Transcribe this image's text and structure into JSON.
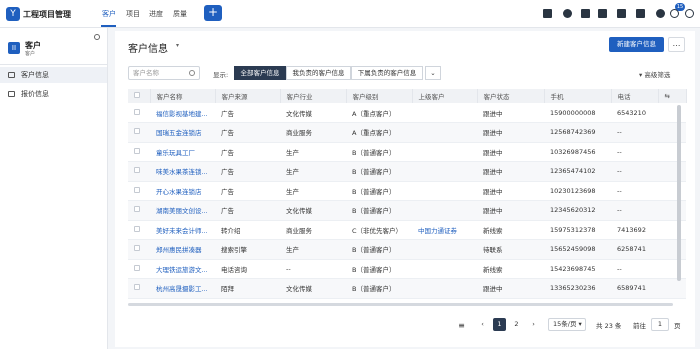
{
  "app": {
    "title": "工程项目管理",
    "logo_char": "Y"
  },
  "nav": {
    "tabs": [
      "客户",
      "项目",
      "进度",
      "质量"
    ],
    "active": "客户"
  },
  "topbar": {
    "plus": "+",
    "notify_count": "15"
  },
  "sidebar": {
    "title": "客户",
    "subtitle": "客户",
    "icon_char": "II",
    "items": [
      "客户信息",
      "报价信息"
    ]
  },
  "page": {
    "title": "客户信息",
    "caret": "▾",
    "new_button": "新建客户信息",
    "more": "…"
  },
  "toolbar": {
    "search_placeholder": "客户名称",
    "show_label": "显示:",
    "segments": [
      "全部客户信息",
      "我负责的客户信息",
      "下属负责的客户信息"
    ],
    "segment_caret": "⌄",
    "filter": "高级筛选"
  },
  "table": {
    "headers": [
      "客户名称",
      "客户来源",
      "客户行业",
      "客户级别",
      "上级客户",
      "客户状态",
      "手机",
      "电话"
    ],
    "rows": [
      [
        "福信影视基地建...",
        "广告",
        "文化传媒",
        "A（重点客户）",
        "",
        "跟进中",
        "15900000008",
        "6543210"
      ],
      [
        "国瑞五金连锁店",
        "广告",
        "商业服务",
        "A（重点客户）",
        "",
        "跟进中",
        "12568742369",
        "--"
      ],
      [
        "童乐玩具工厂",
        "广告",
        "生产",
        "B（普通客户）",
        "",
        "跟进中",
        "10326987456",
        "--"
      ],
      [
        "味美水果茶连锁...",
        "广告",
        "生产",
        "B（普通客户）",
        "",
        "跟进中",
        "12365474102",
        "--"
      ],
      [
        "开心水果连锁店",
        "广告",
        "生产",
        "B（普通客户）",
        "",
        "跟进中",
        "10230123698",
        "--"
      ],
      [
        "湖南美丽文创设...",
        "广告",
        "文化传媒",
        "B（普通客户）",
        "",
        "跟进中",
        "12345620312",
        "--"
      ],
      [
        "美好未来会计师...",
        "转介绍",
        "商业服务",
        "C（非优先客户）",
        "中国力通证券",
        "新线索",
        "15975312378",
        "7413692"
      ],
      [
        "郑州惠民拼凑器",
        "搜索引擎",
        "生产",
        "B（普通客户）",
        "",
        "待联系",
        "15652459098",
        "6258741"
      ],
      [
        "大理铁运旅游文...",
        "电话咨询",
        "--",
        "B（普通客户）",
        "",
        "新线索",
        "15423698745",
        "--"
      ],
      [
        "杭州高晟摄影工...",
        "陌拜",
        "文化传媒",
        "B（普通客户）",
        "",
        "跟进中",
        "13365230236",
        "6589741"
      ]
    ]
  },
  "pager": {
    "pages": [
      "1",
      "2"
    ],
    "current": "1",
    "next": "›",
    "prev": "‹",
    "page_size": "15条/页",
    "total": "共 23 条",
    "goto_label": "前往",
    "goto_value": "1",
    "goto_unit": "页"
  }
}
